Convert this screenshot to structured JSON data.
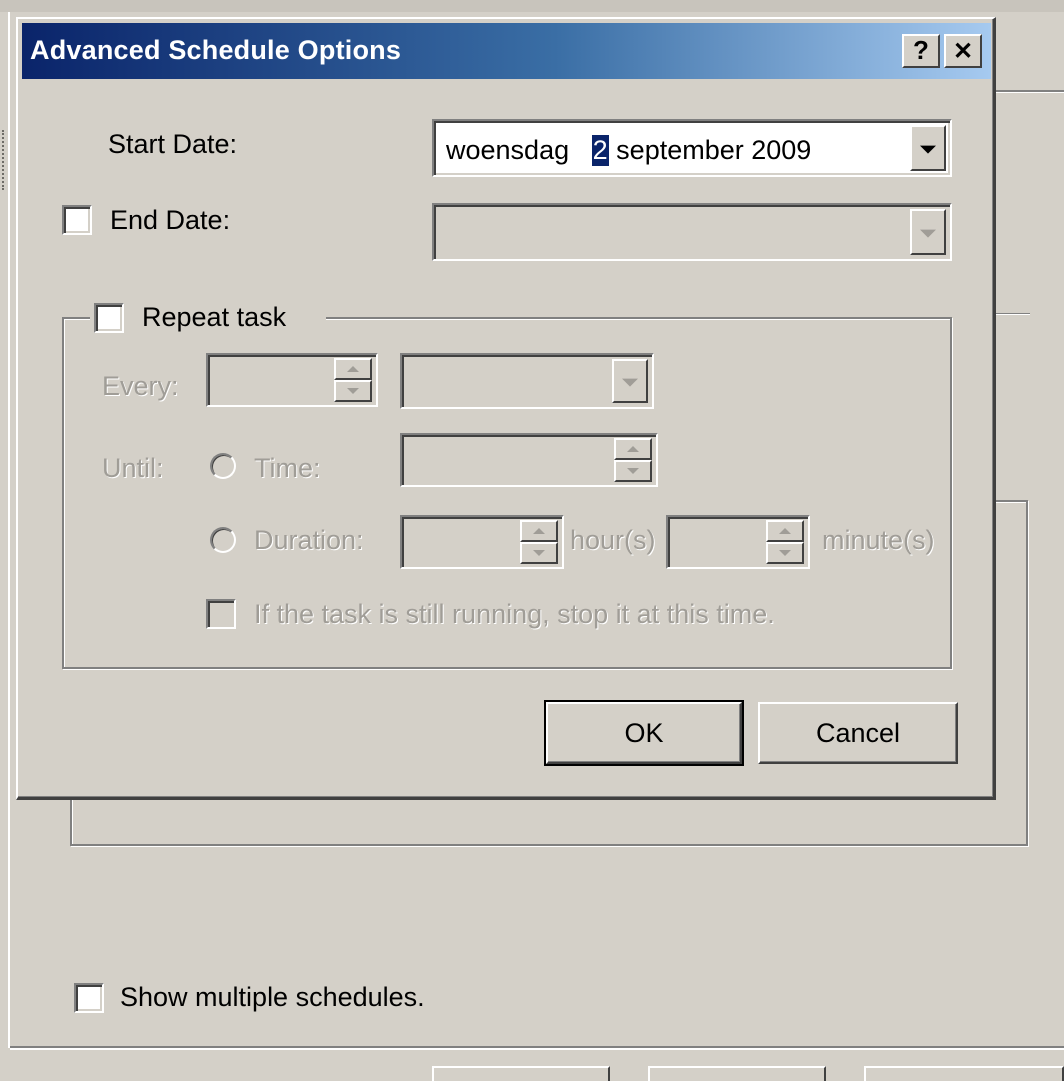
{
  "dialog": {
    "title": "Advanced Schedule Options",
    "help_glyph": "?",
    "close_glyph": "✕",
    "start_date_label": "Start Date:",
    "start_date": {
      "weekday": "woensdag",
      "day": "2",
      "month_year": "september 2009"
    },
    "end_date_label": "End Date:",
    "end_date_checked": false,
    "end_date_value": "",
    "repeat_task_label": "Repeat task",
    "repeat_task_checked": false,
    "every_label": "Every:",
    "every_value": "",
    "every_unit": "",
    "until_label": "Until:",
    "time_label": "Time:",
    "time_value": "",
    "duration_label": "Duration:",
    "duration_hours": "",
    "hours_label": "hour(s)",
    "duration_minutes": "",
    "minutes_label": "minute(s)",
    "stop_task_label": "If the task is still running, stop it at this time.",
    "ok_label": "OK",
    "cancel_label": "Cancel"
  },
  "background": {
    "show_multiple_label": "Show multiple schedules.",
    "show_multiple_checked": false
  },
  "colors": {
    "titlebar_start": "#0a246a",
    "titlebar_end": "#a6caf0",
    "face": "#d4d0c8",
    "disabled_text": "#a09d97"
  }
}
